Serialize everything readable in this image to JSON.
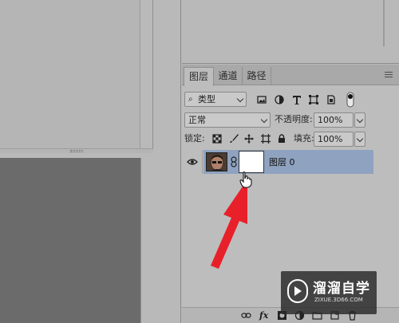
{
  "layers_panel": {
    "tabs": [
      {
        "label": "图层",
        "active": true
      },
      {
        "label": "通道",
        "active": false
      },
      {
        "label": "路径",
        "active": false
      }
    ],
    "filter": {
      "selected": "类型",
      "icon": "search-icon"
    },
    "blend_mode": {
      "selected": "正常"
    },
    "opacity": {
      "label": "不透明度:",
      "value": "100%"
    },
    "lock": {
      "label": "锁定:"
    },
    "fill": {
      "label": "填充:",
      "value": "100%"
    },
    "layer": {
      "name": "图层 0",
      "visible": true
    },
    "filter_icons": [
      "image-filter-icon",
      "adjustment-filter-icon",
      "type-filter-icon",
      "shape-filter-icon",
      "smart-object-filter-icon",
      "filter-toggle-icon"
    ],
    "lock_icons": [
      "lock-transparent-icon",
      "lock-pixels-icon",
      "lock-position-icon",
      "lock-artboard-icon",
      "lock-all-icon"
    ],
    "bottom_icons": [
      "link-layers-icon",
      "fx-icon",
      "add-mask-icon",
      "adjustment-layer-icon",
      "group-icon",
      "new-layer-icon",
      "delete-icon"
    ]
  },
  "watermark": {
    "title": "溜溜自学",
    "subtitle": "ZIXUE.3D66.COM"
  },
  "colors": {
    "selected_layer": "#8fa2bf",
    "arrow": "#e8202a",
    "dark_canvas": "#6b6b6b"
  }
}
